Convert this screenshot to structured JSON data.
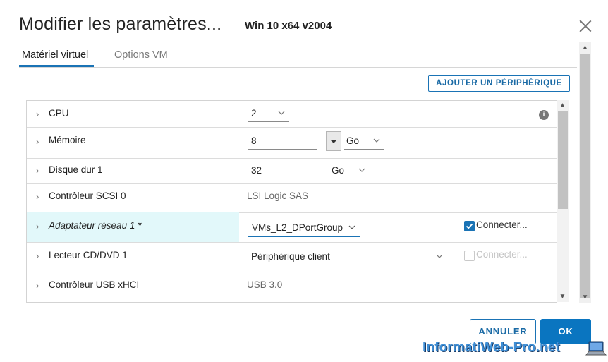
{
  "header": {
    "title": "Modifier les paramètres...",
    "vm_name": "Win 10 x64 v2004"
  },
  "tabs": [
    {
      "label": "Matériel virtuel",
      "active": true
    },
    {
      "label": "Options VM",
      "active": false
    }
  ],
  "toolbar": {
    "add_device_label": "AJOUTER UN PÉRIPHÉRIQUE"
  },
  "devices": {
    "cpu": {
      "label": "CPU",
      "value": "2"
    },
    "memory": {
      "label": "Mémoire",
      "value": "8",
      "unit": "Go"
    },
    "disk": {
      "label": "Disque dur 1",
      "value": "32",
      "unit": "Go"
    },
    "scsi": {
      "label": "Contrôleur SCSI 0",
      "value": "LSI Logic SAS"
    },
    "network": {
      "label": "Adaptateur réseau 1 *",
      "value": "VMs_L2_DPortGroup",
      "connect_label": "Connecter...",
      "connected": true
    },
    "cdrom": {
      "label": "Lecteur CD/DVD 1",
      "value": "Périphérique client",
      "connect_label": "Connecter...",
      "connected": false
    },
    "usb": {
      "label": "Contrôleur USB xHCI",
      "value": "USB 3.0"
    }
  },
  "footer": {
    "cancel_label": "ANNULER",
    "ok_label": "OK"
  },
  "watermark": {
    "text": "InformatiWeb-Pro.net"
  },
  "colors": {
    "accent": "#1a73b5",
    "primary_button": "#0a75c0",
    "highlight_row": "#e2f8fa",
    "watermark": "#3f8fd6"
  },
  "icons": [
    "close-icon",
    "chevron-right-icon",
    "chevron-down-icon",
    "info-icon",
    "checkbox-icon",
    "scroll-up-icon",
    "scroll-down-icon"
  ]
}
